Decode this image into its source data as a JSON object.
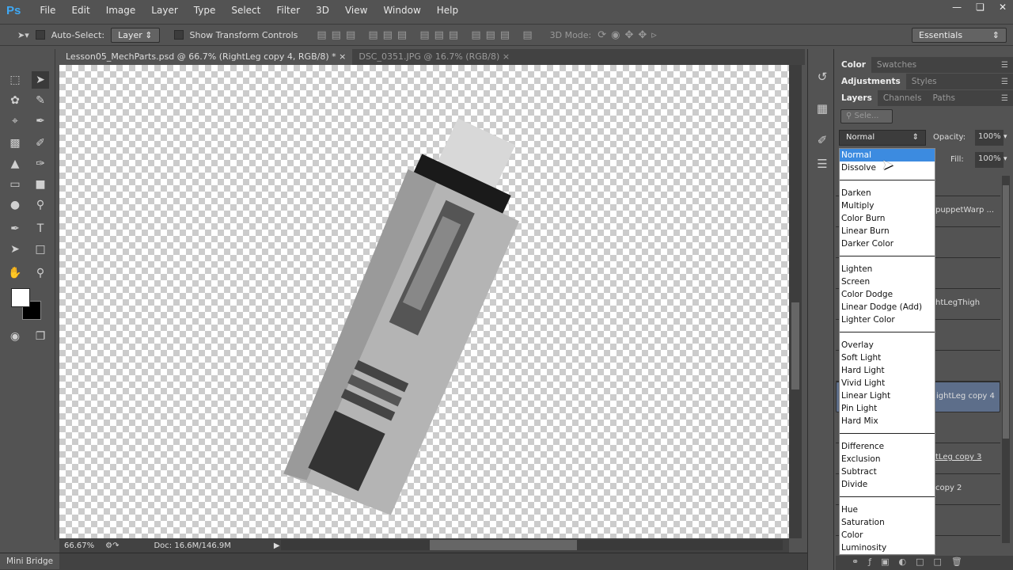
{
  "app": {
    "logo": "Ps",
    "menus": [
      "File",
      "Edit",
      "Image",
      "Layer",
      "Type",
      "Select",
      "Filter",
      "3D",
      "View",
      "Window",
      "Help"
    ],
    "window_buttons": [
      "minimize",
      "restore",
      "close"
    ]
  },
  "options": {
    "auto_select_label": "Auto-Select:",
    "auto_select_target": "Layer",
    "show_transform_label": "Show Transform Controls",
    "mode_3d_label": "3D Mode:",
    "workspace": "Essentials"
  },
  "tabs": [
    {
      "label": "Lesson05_MechParts.psd @ 66.7% (RightLeg copy 4, RGB/8) *",
      "active": true
    },
    {
      "label": "DSC_0351.JPG @ 16.7% (RGB/8)",
      "active": false
    }
  ],
  "status": {
    "zoom": "66.67%",
    "doc": "Doc: 16.6M/146.9M"
  },
  "mini_bridge": "Mini Bridge",
  "panels": {
    "group1": [
      "Color",
      "Swatches"
    ],
    "group2": [
      "Adjustments",
      "Styles"
    ],
    "group3": [
      "Layers",
      "Channels",
      "Paths"
    ],
    "filter_placeholder": "Sele...",
    "blend_mode": "Normal",
    "opacity_label": "Opacity:",
    "opacity": "100%",
    "fill_label": "Fill:",
    "fill": "100%"
  },
  "layers": [
    "",
    "puppetWarp ...",
    "",
    "",
    "htLegThigh",
    "",
    "",
    "ightLeg copy 4",
    "",
    "tLeg copy 3",
    "copy 2",
    ""
  ],
  "blend_modes": [
    [
      "Normal",
      "Dissolve"
    ],
    [
      "Darken",
      "Multiply",
      "Color Burn",
      "Linear Burn",
      "Darker Color"
    ],
    [
      "Lighten",
      "Screen",
      "Color Dodge",
      "Linear Dodge (Add)",
      "Lighter Color"
    ],
    [
      "Overlay",
      "Soft Light",
      "Hard Light",
      "Vivid Light",
      "Linear Light",
      "Pin Light",
      "Hard Mix"
    ],
    [
      "Difference",
      "Exclusion",
      "Subtract",
      "Divide"
    ],
    [
      "Hue",
      "Saturation",
      "Color",
      "Luminosity"
    ]
  ]
}
